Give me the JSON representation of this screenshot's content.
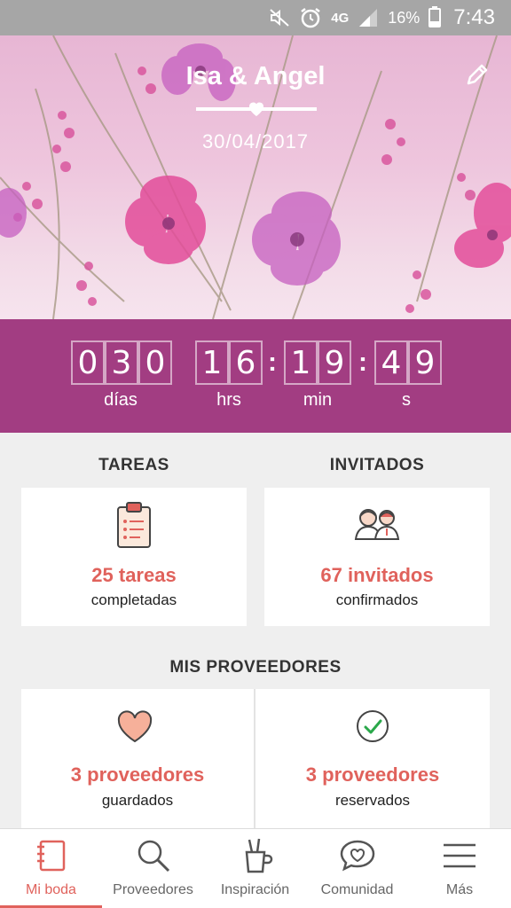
{
  "status_bar": {
    "time": "7:43",
    "battery": "16%",
    "network": "4G",
    "icons": [
      "mute-icon",
      "alarm-icon",
      "signal-icon",
      "battery-icon"
    ]
  },
  "header": {
    "couple_names": "Isa & Angel",
    "wedding_date": "30/04/2017",
    "edit_icon": "pencil-icon"
  },
  "countdown": {
    "days": [
      "0",
      "3",
      "0"
    ],
    "hours": [
      "1",
      "6"
    ],
    "minutes": [
      "1",
      "9"
    ],
    "seconds": [
      "4",
      "9"
    ],
    "labels": {
      "days": "días",
      "hours": "hrs",
      "minutes": "min",
      "seconds": "s"
    }
  },
  "tasks": {
    "title": "TAREAS",
    "count": "25 tareas",
    "sub": "completadas",
    "icon": "clipboard-icon"
  },
  "guests": {
    "title": "INVITADOS",
    "count": "67 invitados",
    "sub": "confirmados",
    "icon": "guests-icon"
  },
  "vendors": {
    "title": "MIS PROVEEDORES",
    "saved": {
      "count": "3 proveedores",
      "sub": "guardados",
      "icon": "heart-icon"
    },
    "booked": {
      "count": "3 proveedores",
      "sub": "reservados",
      "icon": "check-circle-icon"
    }
  },
  "bottom_nav": {
    "items": [
      {
        "label": "Mi boda",
        "icon": "notebook-icon",
        "active": true
      },
      {
        "label": "Proveedores",
        "icon": "search-icon",
        "active": false
      },
      {
        "label": "Inspiración",
        "icon": "pencil-cup-icon",
        "active": false
      },
      {
        "label": "Comunidad",
        "icon": "chat-heart-icon",
        "active": false
      },
      {
        "label": "Más",
        "icon": "menu-icon",
        "active": false
      }
    ]
  },
  "colors": {
    "accent": "#e0625c",
    "countdown_bg": "#a23d82",
    "status_bar": "#a6a6a6"
  }
}
